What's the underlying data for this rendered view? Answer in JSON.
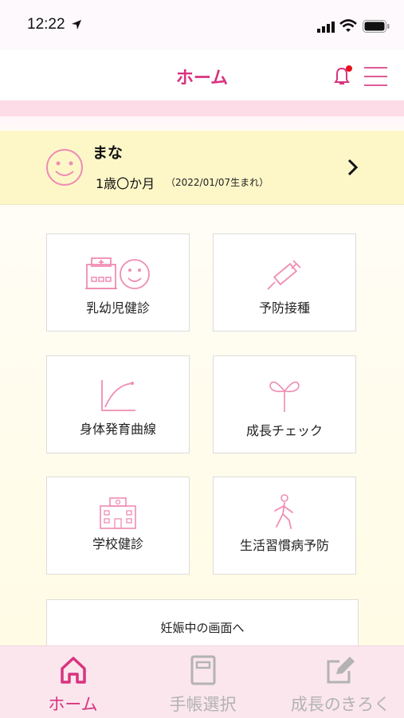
{
  "status_bar": {
    "time": "12:22"
  },
  "header": {
    "title": "ホーム",
    "notification_dot": "#e8101e"
  },
  "child": {
    "name": "まな",
    "age": "1歳〇か月",
    "birth": "（2022/01/07生まれ）"
  },
  "menu_tiles": [
    {
      "label": "乳幼児健診",
      "icon": "hospital-smiley-icon"
    },
    {
      "label": "予防接種",
      "icon": "syringe-icon"
    },
    {
      "label": "身体発育曲線",
      "icon": "growth-curve-icon"
    },
    {
      "label": "成長チェック",
      "icon": "sprout-icon"
    },
    {
      "label": "学校健診",
      "icon": "school-icon"
    },
    {
      "label": "生活習慣病予防",
      "icon": "walking-person-icon"
    }
  ],
  "pregnancy_link": "妊娠中の画面へ",
  "tabbar": {
    "tabs": [
      {
        "label": "ホーム",
        "icon": "home-icon",
        "active": true
      },
      {
        "label": "手帳選択",
        "icon": "notebook-icon",
        "active": false
      },
      {
        "label": "成長のきろく",
        "icon": "edit-icon",
        "active": false
      }
    ]
  },
  "colors": {
    "accent": "#d8347f",
    "icon_pink": "#f08cb3",
    "card_yellow": "#fdf7c8",
    "band_pink": "#fddbe7"
  }
}
